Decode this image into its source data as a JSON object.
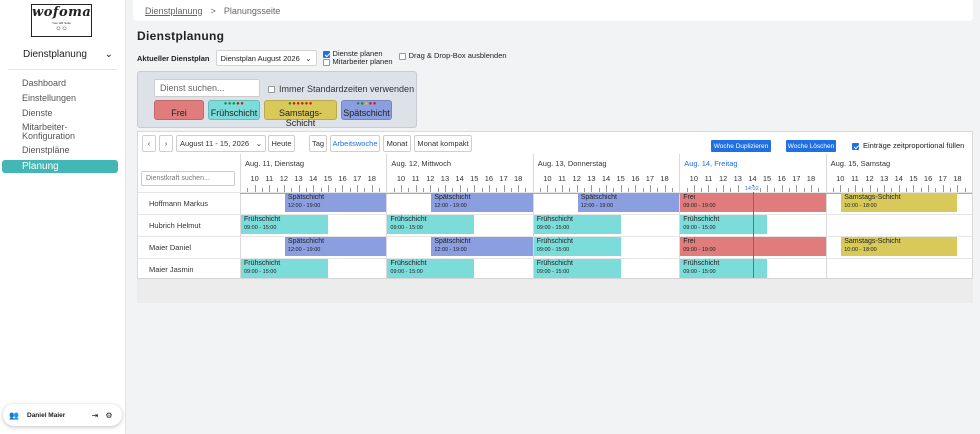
{
  "app": {
    "logo_text": "wofoma",
    "logo_tagline": "Your HR Suite"
  },
  "sidebar": {
    "selector_label": "Dienstplanung",
    "items": [
      {
        "label": "Dashboard"
      },
      {
        "label": "Einstellungen"
      },
      {
        "label": "Dienste"
      },
      {
        "label": "Mitarbeiter-\nKonfiguration"
      },
      {
        "label": "Dienstpläne"
      },
      {
        "label": "Planung",
        "active": true
      }
    ],
    "user_name": "Daniel Maier"
  },
  "breadcrumb": {
    "items": [
      "Dienstplanung",
      "Planungsseite"
    ],
    "separator": ">"
  },
  "page": {
    "title": "Dienstplanung"
  },
  "plan_controls": {
    "current_plan_label": "Aktueller Dienstplan",
    "current_plan_value": "Dienstplan August 2026",
    "plan_shifts_label": "Dienste planen",
    "plan_shifts_checked": true,
    "plan_staff_label": "Mitarbeiter planen",
    "plan_staff_checked": false,
    "hide_dnd_label": "Drag & Drop-Box ausblenden",
    "hide_dnd_checked": false
  },
  "drag_box": {
    "search_placeholder": "Dienst suchen...",
    "standard_times_label": "Immer Standardzeiten verwenden",
    "standard_times_checked": false,
    "chips": [
      {
        "name": "Frei",
        "color": "#e07c7c",
        "dots": []
      },
      {
        "name": "Frühschicht",
        "color": "#7cdcda",
        "dots": [
          "#1f8a3b",
          "#1f8a3b",
          "#1f8a3b",
          "#c02020",
          "#c02020"
        ]
      },
      {
        "name": "Samstags-Schicht",
        "color": "#d8c95a",
        "dots": [
          "#1f8a3b",
          "#c02020",
          "#c02020",
          "#c02020",
          "#c02020",
          "#c02020"
        ]
      },
      {
        "name": "Spätschicht",
        "color": "#8a9ee0",
        "dots": [
          "#1f8a3b",
          "#1f8a3b",
          "#e0c020",
          "#c02020",
          "#c02020"
        ]
      }
    ]
  },
  "calendar_toolbar": {
    "prev_label": "‹",
    "next_label": "›",
    "range_label": "August 11 - 15, 2026",
    "today_label": "Heute",
    "views": [
      "Tag",
      "Arbeitswoche",
      "Monat",
      "Monat kompakt"
    ],
    "active_view": "Arbeitswoche",
    "duplicate_week_label": "Woche Duplizieren",
    "delete_week_label": "Woche Löschen",
    "proportional_label": "Einträge zeitproportional füllen",
    "proportional_checked": true
  },
  "calendar": {
    "employee_search_placeholder": "Dienstkraft suchen...",
    "hour_labels": [
      "10",
      "11",
      "12",
      "13",
      "14",
      "15",
      "16",
      "17",
      "18"
    ],
    "now_label": "14:02",
    "days": [
      {
        "label": "Aug. 11, Dienstag",
        "today": false
      },
      {
        "label": "Aug. 12, Mittwoch",
        "today": false
      },
      {
        "label": "Aug. 13, Donnerstag",
        "today": false
      },
      {
        "label": "Aug. 14, Freitag",
        "today": true
      },
      {
        "label": "Aug. 15, Samstag",
        "today": false
      }
    ],
    "employees": [
      {
        "name": "Hoffmann Markus"
      },
      {
        "name": "Hubrich Helmut"
      },
      {
        "name": "Maier Daniel"
      },
      {
        "name": "Maier Jasmin"
      }
    ],
    "shifts": [
      {
        "emp": 0,
        "day": 0,
        "title": "Spätschicht",
        "time": "12:00 - 19:00",
        "start": 12,
        "end": 19,
        "color": "#8a9ee0"
      },
      {
        "emp": 0,
        "day": 1,
        "title": "Spätschicht",
        "time": "12:00 - 19:00",
        "start": 12,
        "end": 19,
        "color": "#8a9ee0"
      },
      {
        "emp": 0,
        "day": 2,
        "title": "Spätschicht",
        "time": "12:00 - 19:00",
        "start": 12,
        "end": 19,
        "color": "#8a9ee0"
      },
      {
        "emp": 0,
        "day": 3,
        "title": "Frei",
        "time": "09:00 - 19:00",
        "start": 9,
        "end": 19,
        "color": "#e07c7c"
      },
      {
        "emp": 0,
        "day": 4,
        "title": "Samstags-Schicht",
        "time": "10:00 - 18:00",
        "start": 10,
        "end": 18,
        "color": "#d8c95a"
      },
      {
        "emp": 1,
        "day": 0,
        "title": "Frühschicht",
        "time": "09:00 - 15:00",
        "start": 9,
        "end": 15,
        "color": "#7cdcda"
      },
      {
        "emp": 1,
        "day": 1,
        "title": "Frühschicht",
        "time": "09:00 - 15:00",
        "start": 9,
        "end": 15,
        "color": "#7cdcda"
      },
      {
        "emp": 1,
        "day": 2,
        "title": "Frühschicht",
        "time": "09:00 - 15:00",
        "start": 9,
        "end": 15,
        "color": "#7cdcda"
      },
      {
        "emp": 1,
        "day": 3,
        "title": "Frühschicht",
        "time": "09:00 - 15:00",
        "start": 9,
        "end": 15,
        "color": "#7cdcda"
      },
      {
        "emp": 2,
        "day": 0,
        "title": "Spätschicht",
        "time": "12:00 - 19:00",
        "start": 12,
        "end": 19,
        "color": "#8a9ee0"
      },
      {
        "emp": 2,
        "day": 1,
        "title": "Spätschicht",
        "time": "12:00 - 19:00",
        "start": 12,
        "end": 19,
        "color": "#8a9ee0"
      },
      {
        "emp": 2,
        "day": 2,
        "title": "Frühschicht",
        "time": "09:00 - 15:00",
        "start": 9,
        "end": 15,
        "color": "#7cdcda"
      },
      {
        "emp": 2,
        "day": 3,
        "title": "Frei",
        "time": "09:00 - 19:00",
        "start": 9,
        "end": 19,
        "color": "#e07c7c"
      },
      {
        "emp": 2,
        "day": 4,
        "title": "Samstags-Schicht",
        "time": "10:00 - 18:00",
        "start": 10,
        "end": 18,
        "color": "#d8c95a"
      },
      {
        "emp": 3,
        "day": 0,
        "title": "Frühschicht",
        "time": "09:00 - 15:00",
        "start": 9,
        "end": 15,
        "color": "#7cdcda"
      },
      {
        "emp": 3,
        "day": 1,
        "title": "Frühschicht",
        "time": "09:00 - 15:00",
        "start": 9,
        "end": 15,
        "color": "#7cdcda"
      },
      {
        "emp": 3,
        "day": 2,
        "title": "Frühschicht",
        "time": "09:00 - 15:00",
        "start": 9,
        "end": 15,
        "color": "#7cdcda"
      },
      {
        "emp": 3,
        "day": 3,
        "title": "Frühschicht",
        "time": "09:00 - 15:00",
        "start": 9,
        "end": 15,
        "color": "#7cdcda"
      }
    ]
  }
}
